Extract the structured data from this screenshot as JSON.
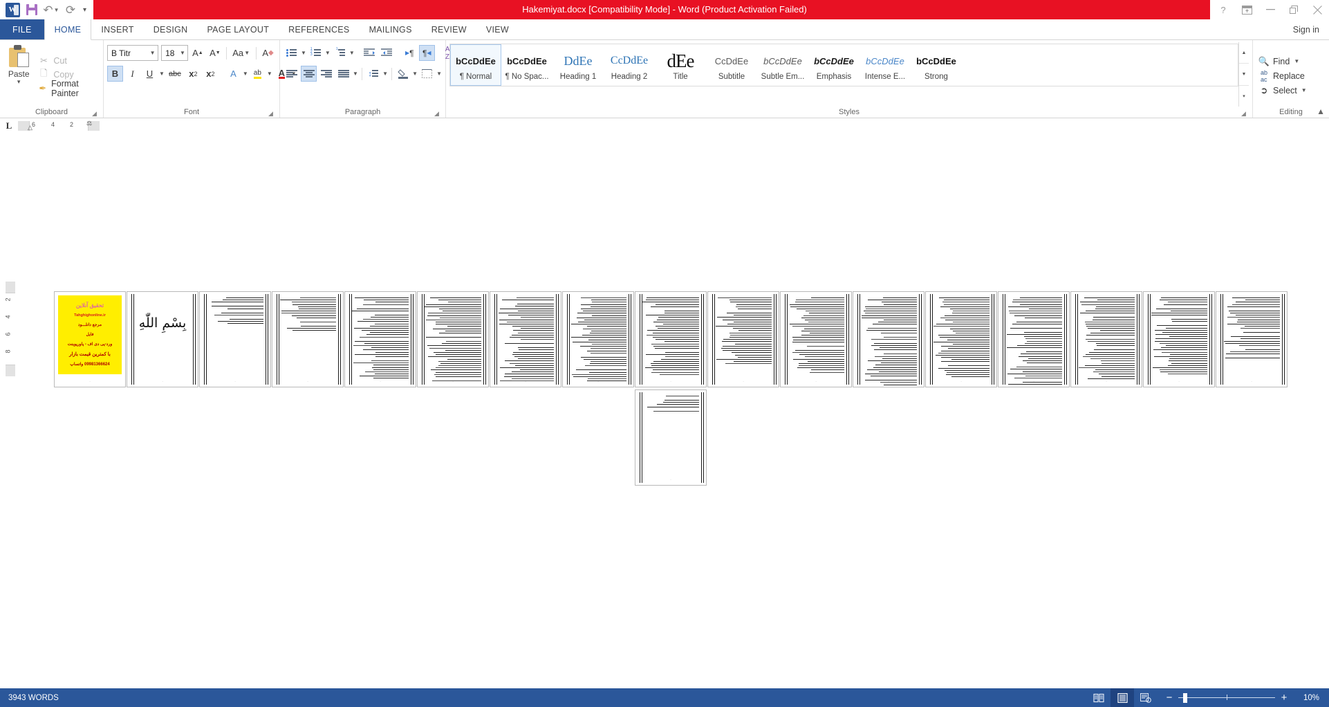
{
  "titlebar": {
    "document_title": "Hakemiyat.docx [Compatibility Mode]  -  Word (Product Activation Failed)",
    "qat": [
      {
        "name": "word-logo",
        "label": "W"
      },
      {
        "name": "save",
        "label": "Save"
      },
      {
        "name": "undo",
        "label": "Undo"
      },
      {
        "name": "redo",
        "label": "Redo"
      },
      {
        "name": "customize",
        "label": "Customize Quick Access Toolbar"
      }
    ],
    "window_controls": [
      {
        "name": "help",
        "label": "?"
      },
      {
        "name": "ribbon-display-options",
        "label": "Ribbon Display Options"
      },
      {
        "name": "minimize",
        "label": "Minimize"
      },
      {
        "name": "restore",
        "label": "Restore Down"
      },
      {
        "name": "close",
        "label": "Close"
      }
    ]
  },
  "tabs": {
    "file": "FILE",
    "items": [
      {
        "label": "HOME",
        "active": true
      },
      {
        "label": "INSERT",
        "active": false
      },
      {
        "label": "DESIGN",
        "active": false
      },
      {
        "label": "PAGE LAYOUT",
        "active": false
      },
      {
        "label": "REFERENCES",
        "active": false
      },
      {
        "label": "MAILINGS",
        "active": false
      },
      {
        "label": "REVIEW",
        "active": false
      },
      {
        "label": "VIEW",
        "active": false
      }
    ],
    "signin": "Sign in"
  },
  "ribbon": {
    "clipboard": {
      "label": "Clipboard",
      "paste": "Paste",
      "cut": "Cut",
      "copy": "Copy",
      "format_painter": "Format Painter"
    },
    "font": {
      "label": "Font",
      "font_name": "B Titr",
      "font_size": "18",
      "grow_font": "A",
      "shrink_font": "A",
      "change_case": "Aa",
      "clear_formatting": "A",
      "bold": "B",
      "italic": "I",
      "underline": "U",
      "strikethrough": "abc",
      "subscript": "x",
      "superscript": "x",
      "text_effects": "A",
      "highlight": "ab",
      "font_color": "A",
      "bold_active": true
    },
    "paragraph": {
      "label": "Paragraph",
      "bullets": "Bullets",
      "numbering": "Numbering",
      "multilevel": "Multilevel List",
      "decrease_indent": "Decrease Indent",
      "increase_indent": "Increase Indent",
      "ltr": "Left-to-Right Text Direction",
      "rtl": "Right-to-Left Text Direction",
      "sort": "Sort",
      "show_marks": "Show/Hide ¶",
      "align_left": "Align Left",
      "align_center": "Center",
      "align_right": "Align Right",
      "justify": "Justify",
      "line_spacing": "Line and Paragraph Spacing",
      "shading": "Shading",
      "borders": "Borders",
      "rtl_active": true,
      "center_active": true
    },
    "styles": {
      "label": "Styles",
      "items": [
        {
          "preview": "bCcDdEe",
          "name": "¶ Normal",
          "selected": true
        },
        {
          "preview": "bCcDdEe",
          "name": "¶ No Spac...",
          "selected": false
        },
        {
          "preview": "DdEe",
          "name": "Heading 1",
          "selected": false
        },
        {
          "preview": "CcDdEe",
          "name": "Heading 2",
          "selected": false
        },
        {
          "preview": "dEe",
          "name": "Title",
          "selected": false
        },
        {
          "preview": "CcDdEe",
          "name": "Subtitle",
          "selected": false
        },
        {
          "preview": "bCcDdEe",
          "name": "Subtle Em...",
          "selected": false
        },
        {
          "preview": "bCcDdEe",
          "name": "Emphasis",
          "selected": false
        },
        {
          "preview": "bCcDdEe",
          "name": "Intense E...",
          "selected": false
        },
        {
          "preview": "bCcDdEe",
          "name": "Strong",
          "selected": false
        }
      ]
    },
    "editing": {
      "label": "Editing",
      "find": "Find",
      "replace": "Replace",
      "select": "Select"
    },
    "collapse_ribbon": "Collapse the Ribbon"
  },
  "ruler": {
    "tab_selector": "L",
    "horizontal_ticks": [
      "6",
      "4",
      "2"
    ],
    "vertical_ticks": [
      "2",
      "4",
      "6",
      "8"
    ]
  },
  "document": {
    "page_count": 18,
    "pages": [
      {
        "index": 1,
        "kind": "advert",
        "ad": {
          "brand": "تحقیق آنلاین",
          "site": "Tahghighonline.ir",
          "line1": "مرجع دانلـــود",
          "line2": "فایل",
          "line3": "ورد-پی دی اف - پاورپوینت",
          "line4": "با کمترین قیمت بازار",
          "phone": "09981366624 واتساپ"
        }
      },
      {
        "index": 2,
        "kind": "bismillah",
        "text": "بِسْمِ اللّٰهِ"
      },
      {
        "index": 3,
        "kind": "sparse",
        "lines": 10
      },
      {
        "index": 4,
        "kind": "sparse",
        "lines": 14
      },
      {
        "index": 5,
        "kind": "text",
        "lines": 34
      },
      {
        "index": 6,
        "kind": "text",
        "lines": 36
      },
      {
        "index": 7,
        "kind": "text",
        "lines": 36
      },
      {
        "index": 8,
        "kind": "text",
        "lines": 37
      },
      {
        "index": 9,
        "kind": "text",
        "lines": 34
      },
      {
        "index": 10,
        "kind": "text",
        "lines": 30
      },
      {
        "index": 11,
        "kind": "text",
        "lines": 33
      },
      {
        "index": 12,
        "kind": "text",
        "lines": 36
      },
      {
        "index": 13,
        "kind": "text",
        "lines": 36
      },
      {
        "index": 14,
        "kind": "text",
        "lines": 36
      },
      {
        "index": 15,
        "kind": "text",
        "lines": 35
      },
      {
        "index": 16,
        "kind": "text",
        "lines": 33
      },
      {
        "index": 17,
        "kind": "text",
        "lines": 24
      },
      {
        "index": 18,
        "kind": "short",
        "lines": 6
      }
    ]
  },
  "statusbar": {
    "word_count": "3943 WORDS",
    "views": [
      {
        "name": "read-mode",
        "selected": false
      },
      {
        "name": "print-layout",
        "selected": true
      },
      {
        "name": "web-layout",
        "selected": false
      }
    ],
    "zoom_out": "−",
    "zoom_in": "+",
    "zoom_level": "10%"
  }
}
